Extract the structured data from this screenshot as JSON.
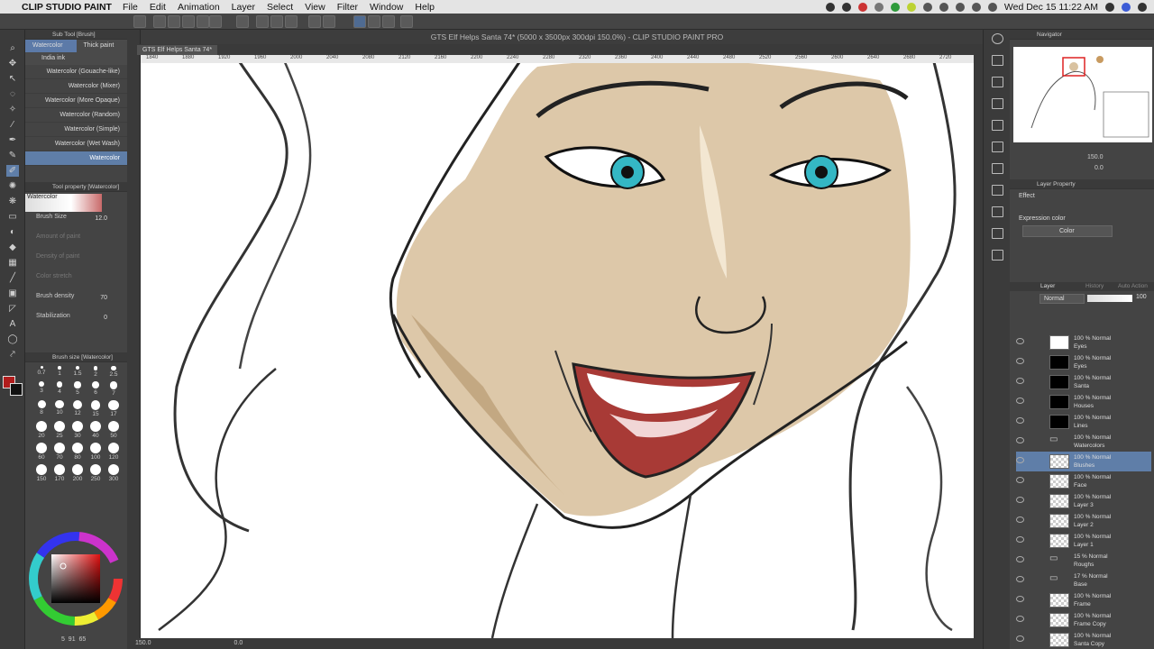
{
  "menubar": {
    "app": "CLIP STUDIO PAINT",
    "items": [
      "File",
      "Edit",
      "Animation",
      "Layer",
      "Select",
      "View",
      "Filter",
      "Window",
      "Help"
    ],
    "clock": "Wed Dec 15  11:22 AM"
  },
  "document": {
    "title": "GTS Elf Helps Santa 74* (5000 x 3500px 300dpi 150.0%)  - CLIP STUDIO PAINT PRO",
    "tab": "GTS Elf Helps Santa 74*"
  },
  "ruler": [
    "1840",
    "1880",
    "1920",
    "1960",
    "2000",
    "2040",
    "2080",
    "2120",
    "2160",
    "2200",
    "2240",
    "2280",
    "2320",
    "2360",
    "2400",
    "2440",
    "2480",
    "2520",
    "2560",
    "2600",
    "2640",
    "2680",
    "2720"
  ],
  "subtool": {
    "header": "Sub Tool [Brush]",
    "tabs": [
      "Watercolor",
      "Thick paint"
    ],
    "group": "India ink",
    "brushes": [
      "Watercolor (Gouache-like)",
      "Watercolor (Mixer)",
      "Watercolor (More Opaque)",
      "Watercolor (Random)",
      "Watercolor (Simple)",
      "Watercolor (Wet Wash)",
      "Watercolor"
    ]
  },
  "toolprop": {
    "header": "Tool property [Watercolor]",
    "name": "Watercolor",
    "brush_size_label": "Brush Size",
    "brush_size": "12.0",
    "amount_label": "Amount of paint",
    "density_label": "Density of paint",
    "stretch_label": "Color stretch",
    "brush_density_label": "Brush density",
    "brush_density": "70",
    "stab_label": "Stabilization",
    "stab": "0"
  },
  "brushsize": {
    "header": "Brush size [Watercolor]",
    "sizes": [
      "0.7",
      "1",
      "1.5",
      "2",
      "2.5",
      "3",
      "4",
      "5",
      "6",
      "7",
      "8",
      "10",
      "12",
      "15",
      "17",
      "20",
      "25",
      "30",
      "40",
      "50",
      "60",
      "70",
      "80",
      "100",
      "120",
      "150",
      "170",
      "200",
      "250",
      "300"
    ]
  },
  "colors": {
    "main": "#b01c1c",
    "sub": "#111111",
    "values": [
      "5",
      "91",
      "65"
    ]
  },
  "navigator": {
    "title": "Navigator",
    "zoom": "150.0",
    "angle": "0.0"
  },
  "layerprop": {
    "title": "Layer Property",
    "effect": "Effect",
    "expr_label": "Expression color",
    "expr_value": "Color"
  },
  "layers": {
    "tabs": [
      "Layer",
      "History",
      "Auto Action"
    ],
    "blend": "Normal",
    "opacity": "100",
    "items": [
      {
        "l1": "100 % Normal",
        "l2": "Eyes",
        "thumb": "white"
      },
      {
        "l1": "100 % Normal",
        "l2": "Eyes",
        "thumb": "blk"
      },
      {
        "l1": "100 % Normal",
        "l2": "Santa",
        "thumb": "blk"
      },
      {
        "l1": "100 % Normal",
        "l2": "Houses",
        "thumb": "blk"
      },
      {
        "l1": "100 % Normal",
        "l2": "Lines",
        "thumb": "blk"
      },
      {
        "l1": "100 % Normal",
        "l2": "Watercolors",
        "thumb": "folder"
      },
      {
        "l1": "100 % Normal",
        "l2": "Blushes",
        "thumb": "check"
      },
      {
        "l1": "100 % Normal",
        "l2": "Face",
        "thumb": "check"
      },
      {
        "l1": "100 % Normal",
        "l2": "Layer 3",
        "thumb": "check"
      },
      {
        "l1": "100 % Normal",
        "l2": "Layer 2",
        "thumb": "check"
      },
      {
        "l1": "100 % Normal",
        "l2": "Layer 1",
        "thumb": "check"
      },
      {
        "l1": "15 % Normal",
        "l2": "Roughs",
        "thumb": "folder"
      },
      {
        "l1": "17 % Normal",
        "l2": "Base",
        "thumb": "folder"
      },
      {
        "l1": "100 % Normal",
        "l2": "Frame",
        "thumb": "check"
      },
      {
        "l1": "100 % Normal",
        "l2": "Frame Copy",
        "thumb": "check"
      },
      {
        "l1": "100 % Normal",
        "l2": "Santa Copy",
        "thumb": "check"
      }
    ]
  },
  "status": {
    "zoom": "150.0",
    "angle": "0.0"
  }
}
